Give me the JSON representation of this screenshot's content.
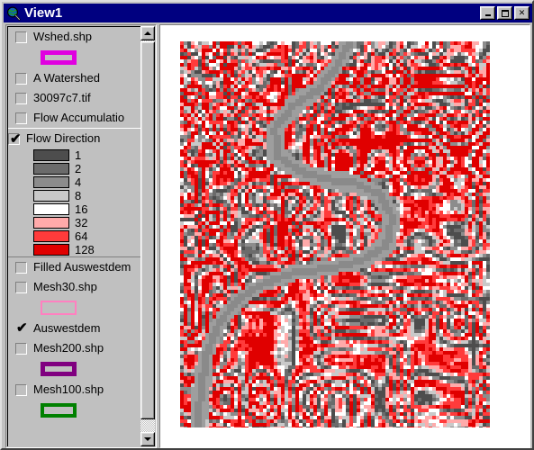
{
  "window": {
    "title": "View1",
    "icon": "globe-magnifier-icon",
    "buttons": {
      "minimize": "minimize-button",
      "maximize": "maximize-button",
      "close_label": "✕"
    }
  },
  "colors": {
    "titlebar": "#000080",
    "face": "#c0c0c0",
    "magenta": "#e000e0",
    "pink": "#ff80c0",
    "purple": "#800080",
    "green": "#008000"
  },
  "toc": {
    "layers": [
      {
        "name": "Wshed.shp",
        "checked": false,
        "active": false,
        "symbol": {
          "type": "polygon-outline",
          "color": "#e000e0",
          "width": 5
        },
        "legend": []
      },
      {
        "name": "A Watershed",
        "checked": false,
        "active": false,
        "symbol": null,
        "legend": []
      },
      {
        "name": "30097c7.tif",
        "checked": false,
        "active": false,
        "symbol": null,
        "legend": []
      },
      {
        "name": "Flow Accumulatio",
        "checked": false,
        "active": false,
        "symbol": null,
        "legend": []
      },
      {
        "name": "Flow Direction",
        "checked": true,
        "active": true,
        "symbol": null,
        "legend": [
          {
            "label": "1",
            "color": "#4d4d4d"
          },
          {
            "label": "2",
            "color": "#6b6b6b"
          },
          {
            "label": "4",
            "color": "#8c8c8c"
          },
          {
            "label": "8",
            "color": "#c9c9c9"
          },
          {
            "label": "16",
            "color": "#ffffff"
          },
          {
            "label": "32",
            "color": "#ffaaaa"
          },
          {
            "label": "64",
            "color": "#ff3b3b"
          },
          {
            "label": "128",
            "color": "#e00000"
          }
        ]
      },
      {
        "name": "Filled Auswestdem",
        "checked": false,
        "active": false,
        "symbol": null,
        "legend": []
      },
      {
        "name": "Mesh30.shp",
        "checked": false,
        "active": false,
        "symbol": {
          "type": "polygon-outline",
          "color": "#ff80c0",
          "width": 2
        },
        "legend": []
      },
      {
        "name": "Auswestdem",
        "checked": true,
        "active": false,
        "symbol": null,
        "legend": []
      },
      {
        "name": "Mesh200.shp",
        "checked": false,
        "active": false,
        "symbol": {
          "type": "polygon-outline",
          "color": "#800080",
          "width": 5
        },
        "legend": []
      },
      {
        "name": "Mesh100.shp",
        "checked": false,
        "active": false,
        "symbol": {
          "type": "polygon-outline",
          "color": "#008000",
          "width": 4
        },
        "legend": []
      }
    ],
    "scrollbar": {
      "up_arrow": "scroll-up-arrow",
      "down_arrow": "scroll-down-arrow",
      "thumb": "scroll-thumb"
    }
  },
  "view": {
    "raster_name": "flow-direction-raster",
    "description": "Flow direction grid over shaded terrain with meandering river"
  }
}
